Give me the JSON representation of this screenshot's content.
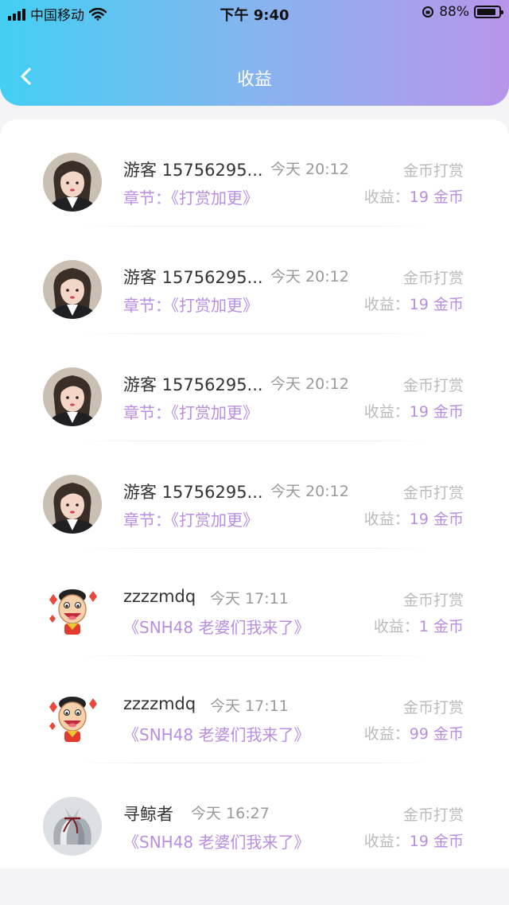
{
  "status_bar": {
    "carrier": "中国移动",
    "time": "下午 9:40",
    "battery": "88%",
    "battery_level": 0.88
  },
  "nav": {
    "title": "收益"
  },
  "records": [
    {
      "name": "游客 15756295...",
      "time": "今天 20:12",
      "type": "金币打赏",
      "chapter_prefix": "章节：",
      "chapter": "《打赏加更》",
      "income_label": "收益：",
      "income_value": "19 金币",
      "avatar": "girl"
    },
    {
      "name": "游客 15756295...",
      "time": "今天 20:12",
      "type": "金币打赏",
      "chapter_prefix": "章节：",
      "chapter": "《打赏加更》",
      "income_label": "收益：",
      "income_value": "19 金币",
      "avatar": "girl"
    },
    {
      "name": "游客 15756295...",
      "time": "今天 20:12",
      "type": "金币打赏",
      "chapter_prefix": "章节：",
      "chapter": "《打赏加更》",
      "income_label": "收益：",
      "income_value": "19 金币",
      "avatar": "girl"
    },
    {
      "name": "游客 15756295...",
      "time": "今天 20:12",
      "type": "金币打赏",
      "chapter_prefix": "章节：",
      "chapter": "《打赏加更》",
      "income_label": "收益：",
      "income_value": "19 金币",
      "avatar": "girl"
    },
    {
      "name": "zzzzmdq",
      "time": "今天 17:11",
      "type": "金币打赏",
      "chapter_prefix": "",
      "chapter": "《SNH48 老婆们我来了》",
      "income_label": "收益：",
      "income_value": "1 金币",
      "avatar": "cartoon"
    },
    {
      "name": "zzzzmdq",
      "time": "今天 17:11",
      "type": "金币打赏",
      "chapter_prefix": "",
      "chapter": "《SNH48 老婆们我来了》",
      "income_label": "收益：",
      "income_value": "99 金币",
      "avatar": "cartoon"
    },
    {
      "name": "寻鲸者",
      "time": "今天 16:27",
      "type": "金币打赏",
      "chapter_prefix": "",
      "chapter": "《SNH48 老婆们我来了》",
      "income_label": "收益：",
      "income_value": "19 金币",
      "avatar": "gift"
    }
  ]
}
